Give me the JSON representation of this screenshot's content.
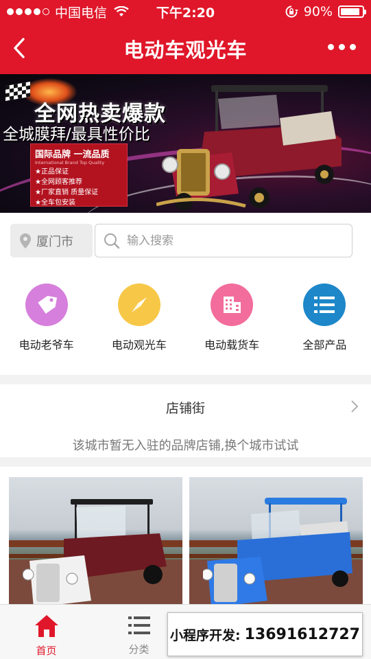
{
  "status_bar": {
    "carrier": "中国电信",
    "time": "下午2:20",
    "battery": "90%",
    "battery_level": 0.9
  },
  "nav": {
    "title": "电动车观光车"
  },
  "banner": {
    "headline": "全网热卖爆款",
    "subheadline": "全城膜拜/最具性价比",
    "box_title": "国际品牌 一流品质",
    "box_subtitle": "International Brand  Top Quality",
    "box_lines": [
      "★正品保证",
      "★全网顾客推荐",
      "★厂家直销 质量保证",
      "★全车包安装"
    ]
  },
  "search": {
    "city": "厦门市",
    "placeholder": "输入搜索",
    "value": ""
  },
  "categories": [
    {
      "label": "电动老爷车",
      "icon": "tag-icon",
      "color": "#d67fdc"
    },
    {
      "label": "电动观光车",
      "icon": "compass-icon",
      "color": "#f7c747"
    },
    {
      "label": "电动载货车",
      "icon": "building-icon",
      "color": "#f26d9b"
    },
    {
      "label": "全部产品",
      "icon": "list-icon",
      "color": "#1d87c9"
    }
  ],
  "store": {
    "title": "店铺街",
    "message": "该城市暂无入驻的品牌店铺,换个城市试试"
  },
  "tabs": [
    {
      "label": "首页",
      "icon": "home-icon",
      "active": true
    },
    {
      "label": "分类",
      "icon": "list-icon",
      "active": false
    }
  ],
  "overlay": {
    "prefix": "小程序开发:",
    "phone": "13691612727"
  },
  "colors": {
    "brand_red": "#e0172a",
    "product_left_car": "#6e1a22",
    "product_right_car": "#2a6fd8"
  }
}
